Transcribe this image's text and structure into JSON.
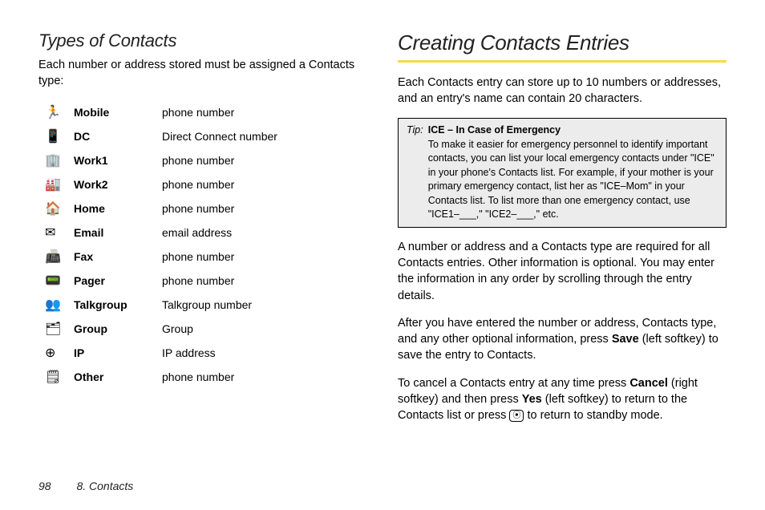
{
  "left": {
    "heading": "Types of Contacts",
    "intro": "Each number or address stored must be assigned a Contacts type:",
    "types": [
      {
        "icon": "🏃",
        "label": "Mobile",
        "desc": "phone number"
      },
      {
        "icon": "📱",
        "label": "DC",
        "desc": "Direct Connect number"
      },
      {
        "icon": "🏢",
        "label": "Work1",
        "desc": "phone number"
      },
      {
        "icon": "🏭",
        "label": "Work2",
        "desc": "phone number"
      },
      {
        "icon": "🏠",
        "label": "Home",
        "desc": "phone number"
      },
      {
        "icon": "✉",
        "label": "Email",
        "desc": "email address"
      },
      {
        "icon": "📠",
        "label": "Fax",
        "desc": "phone number"
      },
      {
        "icon": "📟",
        "label": "Pager",
        "desc": "phone number"
      },
      {
        "icon": "👥",
        "label": "Talkgroup",
        "desc": "Talkgroup number"
      },
      {
        "icon": "🗂",
        "label": "Group",
        "desc": "Group"
      },
      {
        "icon": "⊕",
        "label": "IP",
        "desc": "IP address"
      },
      {
        "icon": "🗒",
        "label": "Other",
        "desc": "phone number"
      }
    ]
  },
  "right": {
    "heading": "Creating Contacts Entries",
    "intro": "Each Contacts entry can store up to 10 numbers or addresses, and an entry's name can contain 20 characters.",
    "tip": {
      "prefix": "Tip:",
      "title": "ICE – In Case of Emergency",
      "body": "To make it easier for emergency personnel to identify important contacts, you can list your local emergency contacts under \"ICE\" in your phone's Contacts list. For example, if your mother is your primary emergency contact, list her as \"ICE–Mom\" in your Contacts list. To list more than one emergency contact, use \"ICE1–___,\" \"ICE2–___,\" etc."
    },
    "p1": "A number or address and a Contacts type are required for all Contacts entries. Other information is optional. You may enter the information in any order by scrolling through the entry details.",
    "p2_a": "After you have entered the number or address, Contacts type, and any other optional information, press ",
    "p2_bold": "Save",
    "p2_b": " (left softkey) to save the entry to Contacts.",
    "p3_a": "To cancel a Contacts entry at any time press ",
    "p3_bold1": "Cancel",
    "p3_b": " (right softkey) and then press ",
    "p3_bold2": "Yes",
    "p3_c": " (left softkey) to return to the Contacts list or press ",
    "p3_glyph": "⦿",
    "p3_d": " to return to standby mode."
  },
  "footer": {
    "page": "98",
    "chapter": "8. Contacts"
  }
}
